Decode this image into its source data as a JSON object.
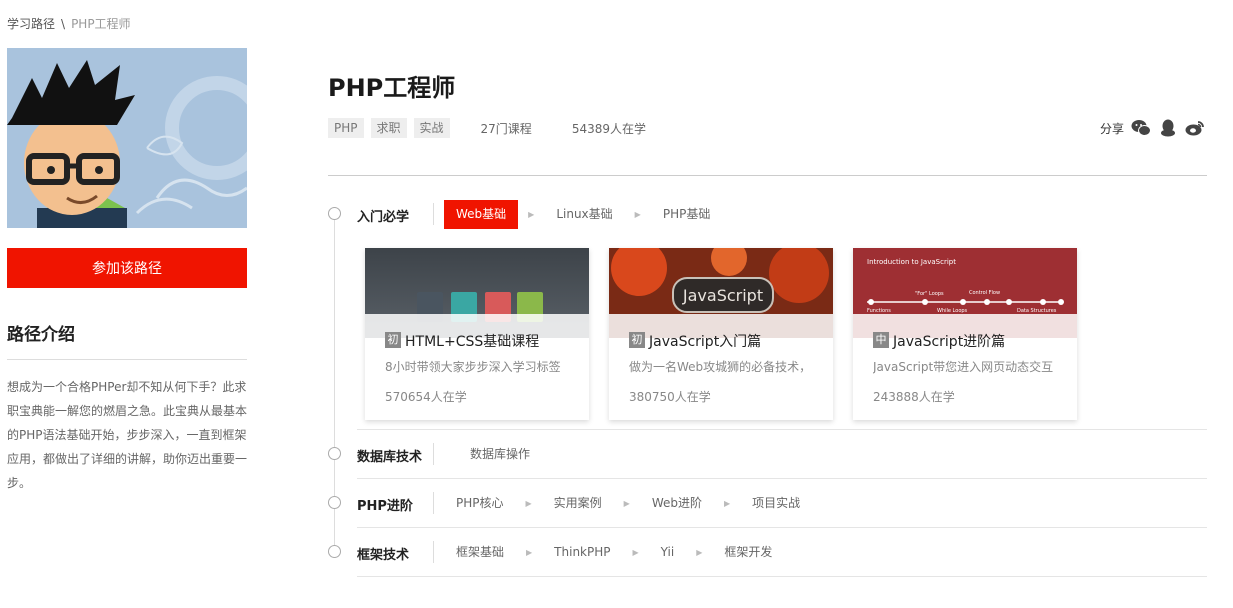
{
  "breadcrumb": {
    "root": "学习路径",
    "separator": "\\",
    "current": "PHP工程师"
  },
  "sidebar": {
    "join_label": "参加该路径",
    "intro_title": "路径介绍",
    "intro_text": "想成为一个合格PHPer却不知从何下手？此求职宝典能一解您的燃眉之急。此宝典从最基本的PHP语法基础开始，步步深入，一直到框架应用，都做出了详细的讲解，助你迈出重要一步。"
  },
  "header": {
    "title": "PHP工程师",
    "tags": [
      "PHP",
      "求职",
      "实战"
    ],
    "course_count": "27门课程",
    "learners": "54389人在学",
    "share_label": "分享"
  },
  "stages": [
    {
      "name": "入门必学",
      "steps": [
        "Web基础",
        "Linux基础",
        "PHP基础"
      ],
      "active_index": 0
    },
    {
      "name": "数据库技术",
      "steps": [
        "数据库操作"
      ],
      "active_index": -1
    },
    {
      "name": "PHP进阶",
      "steps": [
        "PHP核心",
        "实用案例",
        "Web进阶",
        "项目实战"
      ],
      "active_index": -1
    },
    {
      "name": "框架技术",
      "steps": [
        "框架基础",
        "ThinkPHP",
        "Yii",
        "框架开发"
      ],
      "active_index": -1
    }
  ],
  "courses": [
    {
      "level": "初",
      "title": "HTML+CSS基础课程",
      "desc": "8小时带领大家步步深入学习标签",
      "learners": "570654人在学"
    },
    {
      "level": "初",
      "title": "JavaScript入门篇",
      "desc": "做为一名Web攻城狮的必备技术，",
      "learners": "380750人在学",
      "thumb_text": "JavaScript"
    },
    {
      "level": "中",
      "title": "JavaScript进阶篇",
      "desc": "JavaScript带您进入网页动态交互",
      "learners": "243888人在学",
      "thumb_text": "Introduction to JavaScript",
      "thumb_labels": [
        "\"For\" Loops",
        "Control Flow",
        "Functions",
        "While Loops",
        "Data Structures"
      ]
    }
  ],
  "colors": {
    "accent": "#f01400"
  }
}
